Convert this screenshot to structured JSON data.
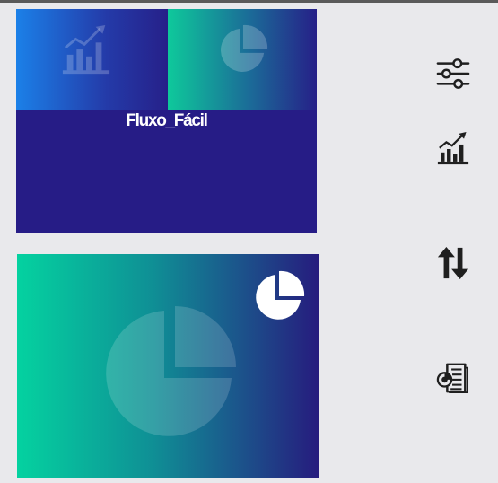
{
  "app": {
    "brand_text": "Fluxo_Fácil"
  },
  "cards": {
    "top": {
      "left_tile_icon": "bar-chart-trend-icon",
      "right_tile_icon": "pie-chart-icon"
    },
    "bottom": {
      "background_icon": "pie-chart-icon",
      "corner_icon": "pie-chart-icon"
    }
  },
  "toolbar": {
    "items": [
      {
        "icon": "sliders-icon"
      },
      {
        "icon": "bar-chart-trend-icon"
      },
      {
        "icon": "sort-arrows-icon"
      },
      {
        "icon": "report-document-icon"
      }
    ]
  },
  "colors": {
    "page_background": "#e9e9ec",
    "card_navy": "#261c86",
    "accent_blue": "#1b80e8",
    "accent_teal": "#04d2a0",
    "icon_dark": "#1f1f1f"
  }
}
